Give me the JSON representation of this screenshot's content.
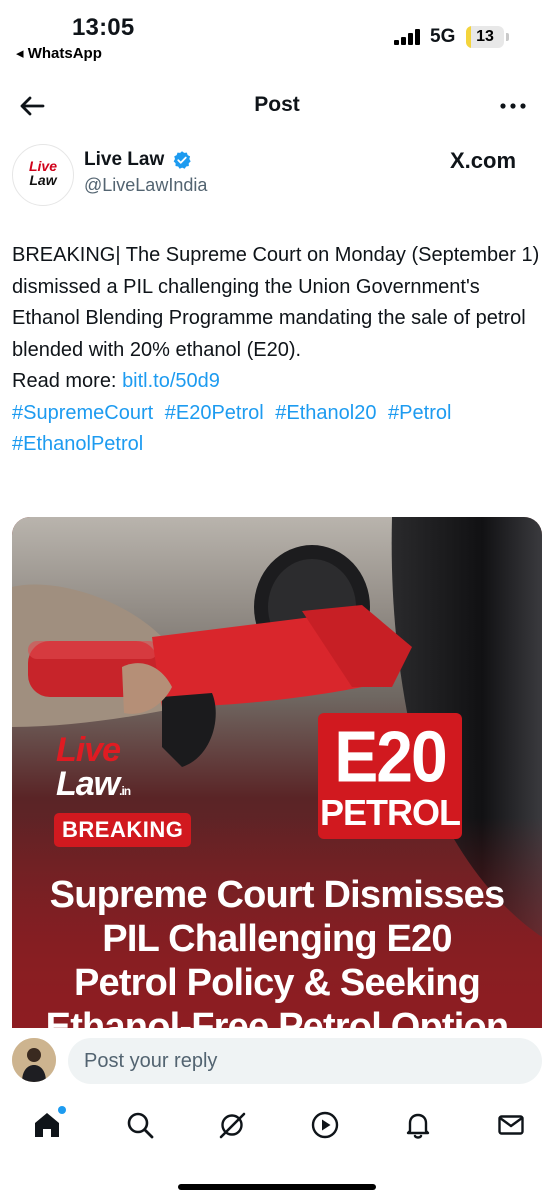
{
  "status_bar": {
    "time": "13:05",
    "back_to_app": "◂ WhatsApp",
    "network": "5G",
    "battery": "13",
    "battery_level": 0.13
  },
  "header": {
    "title": "Post",
    "back_icon": "arrow-left-icon",
    "more_icon": "more-horizontal-icon"
  },
  "author": {
    "name": "Live Law",
    "handle": "@LiveLawIndia",
    "verified": true,
    "avatar_text_1": "Live",
    "avatar_text_2": "Law",
    "source": "X.com"
  },
  "post": {
    "text": "BREAKING| The Supreme Court on Monday (September 1) dismissed a PIL challenging the Union Government's Ethanol Blending Programme mandating the sale of petrol blended with 20% ethanol (E20).",
    "read_more_label": "Read more: ",
    "read_more_link": "bitl.to/50d9",
    "hashtags": [
      "#SupremeCourt",
      "#E20Petrol",
      "#Ethanol20",
      "#Petrol",
      "#EthanolPetrol"
    ]
  },
  "media": {
    "logo_line_1": "Live",
    "logo_line_2": "Law",
    "logo_suffix": ".in",
    "badge_main": "E20",
    "badge_sub": "PETROL",
    "tag": "BREAKING",
    "headline_lines": [
      "Supreme Court Dismisses",
      "PIL Challenging E20",
      "Petrol Policy & Seeking",
      "Ethanol-Free Petrol Option"
    ]
  },
  "reply": {
    "placeholder": "Post your reply"
  },
  "bottom_nav": {
    "items": [
      {
        "icon": "home-icon",
        "active": true
      },
      {
        "icon": "search-icon",
        "active": false
      },
      {
        "icon": "grok-icon",
        "active": false
      },
      {
        "icon": "play-icon",
        "active": false
      },
      {
        "icon": "bell-icon",
        "active": false
      },
      {
        "icon": "mail-icon",
        "active": false
      }
    ]
  },
  "colors": {
    "link": "#1d9bf0",
    "text": "#0f1419",
    "muted": "#536471",
    "brand_red": "#d1191f",
    "battery_fill": "#f4d43c"
  }
}
